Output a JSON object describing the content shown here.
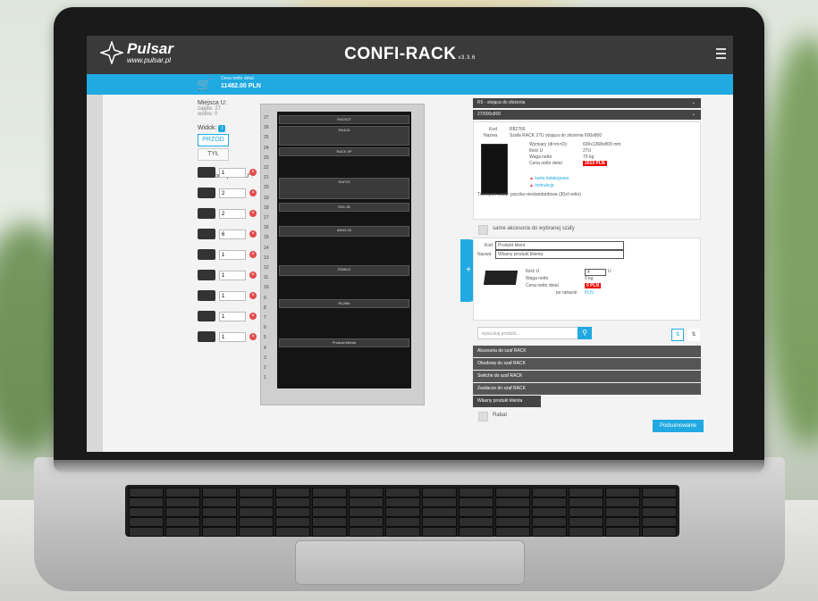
{
  "app": {
    "brand": "Pulsar",
    "brand_url": "www.pulsar.pl",
    "title": "CONFI-RACK",
    "version": "v3.3.6",
    "cart_label": "Cena netto detal",
    "cart_total": "11482.00 PLN"
  },
  "left": {
    "u_title": "Miejsca U:",
    "u_used": "zajęte: 27",
    "u_free": "wolne: 0",
    "view_label": "Widok:",
    "view_front": "PRZÓD",
    "view_back": "TYŁ",
    "acc_title": "Akcesoria poza \"U\":",
    "acc_qty": [
      "1",
      "2",
      "2",
      "6",
      "1",
      "1",
      "1",
      "1",
      "1"
    ]
  },
  "rack": {
    "units": [
      "27",
      "26",
      "25",
      "24",
      "23",
      "22",
      "21",
      "20",
      "19",
      "18",
      "17",
      "16",
      "15",
      "14",
      "13",
      "12",
      "11",
      "10",
      "9",
      "8",
      "7",
      "6",
      "5",
      "4",
      "3",
      "2",
      "1"
    ],
    "devices": [
      "RACK27",
      "RA4U5",
      "RACK 5P",
      "RAPZ3",
      "RA1-38",
      "ARA3-32",
      "R2MUX",
      "RCABv",
      "Produkt klienta"
    ]
  },
  "right": {
    "dropdown1": "R5 - stojąca do złożenia",
    "dropdown2": "27/600x800",
    "kod_label": "Kod",
    "kod_value": "R82766",
    "nazwa_label": "Nazwa",
    "nazwa_value": "Szafa RACK 27U stojąca do złożenia 600x800",
    "specs_labels": [
      "Wymiary (dl×m×D):",
      "Ilość U",
      "Waga netto",
      "Cena netto detal"
    ],
    "specs_values": [
      "600x1368x800 mm",
      "27U",
      "70 kg",
      "2010 PLN"
    ],
    "link_karta": "karta katalogowa",
    "link_instrukcja": "instrukcja",
    "transport": "Transport szafy: paczka niestandardowa (30zł netto)",
    "only_acc": "same akcesoria do wybranej szafy",
    "custom_kod_label": "Kod",
    "custom_kod_value": "Produkt klient",
    "custom_nazwa_label": "Nazwa",
    "custom_nazwa_value": "Własny produkt klienta",
    "custom_specs_labels": [
      "Ilość U",
      "Waga netto",
      "Cena netto detal",
      "po rabacie"
    ],
    "custom_specs_values": [
      "4",
      "0 kg",
      "0 PLN",
      "PLN"
    ],
    "custom_u_suffix": "U",
    "search_placeholder": "wyszukaj produkt...",
    "categories": [
      "Akcesoria do szaf RACK",
      "Obudowy do szaf RACK",
      "Switche do szaf RACK",
      "Zasilacze do szaf RACK"
    ],
    "own_product_tab": "Własny produkt klienta",
    "rabat": "Rabat",
    "summary": "Podsumowanie"
  },
  "colors": {
    "accent": "#21a9e1",
    "header": "#3a3a3a",
    "price": "#ee0000"
  }
}
